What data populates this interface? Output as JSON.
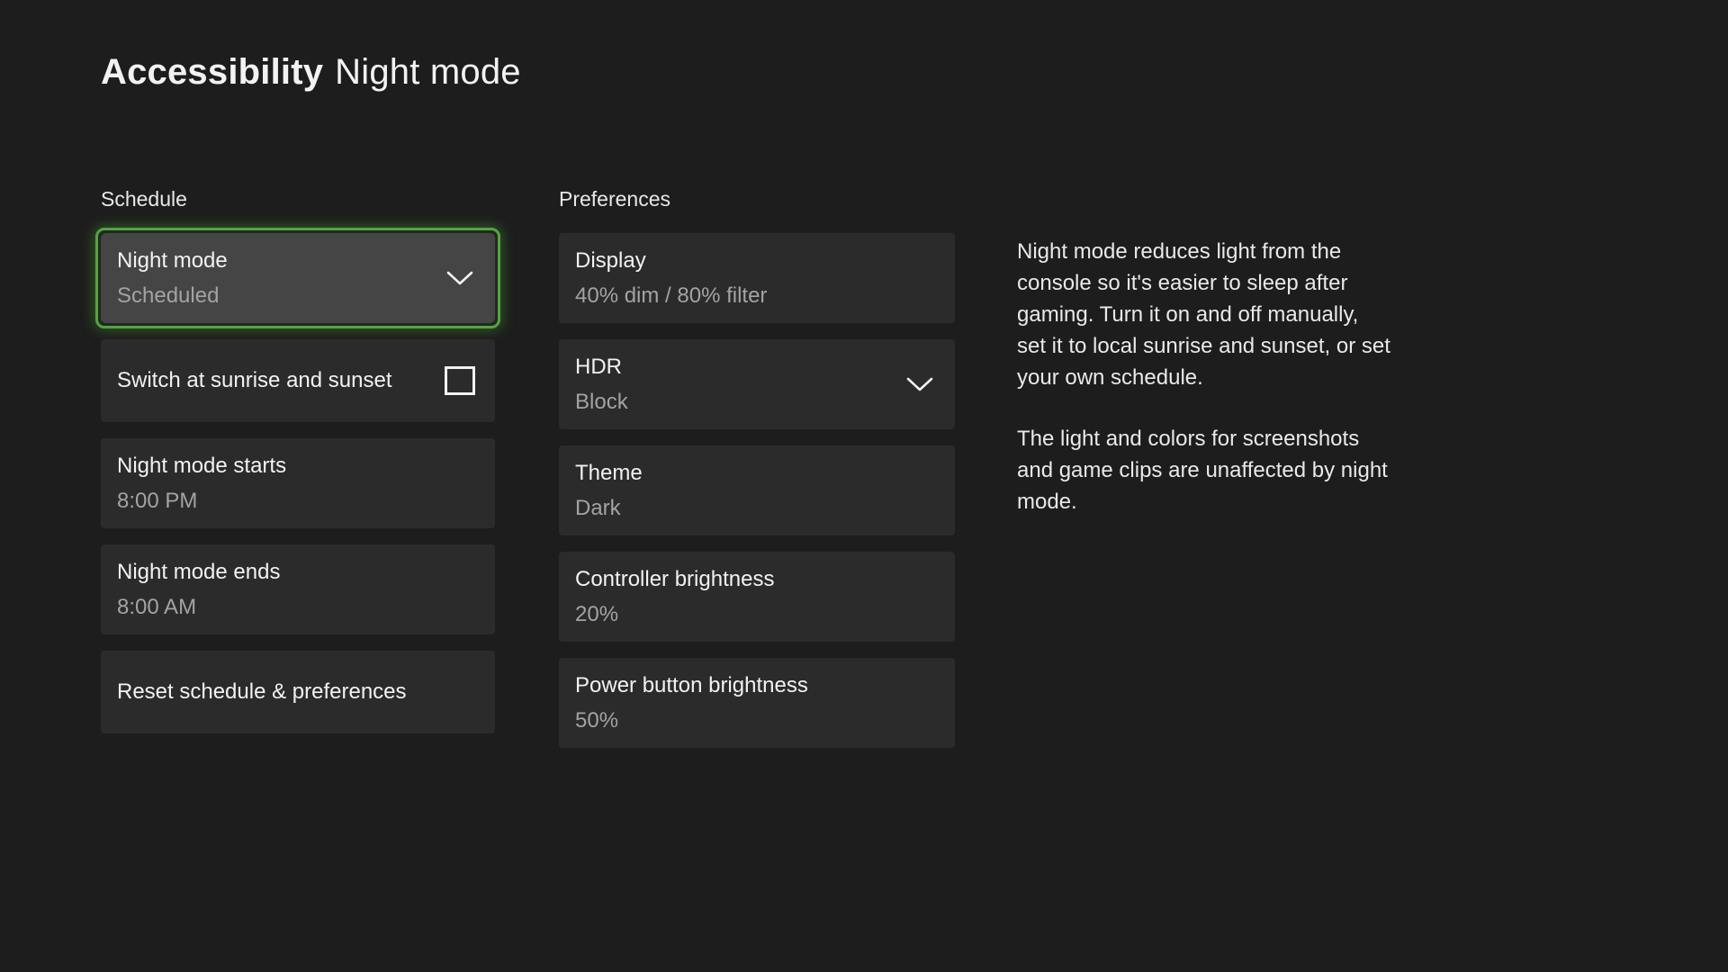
{
  "page": {
    "title_bold": "Accessibility",
    "title_regular": "Night mode"
  },
  "schedule": {
    "heading": "Schedule",
    "night_mode": {
      "label": "Night mode",
      "value": "Scheduled"
    },
    "sunrise_sunset": {
      "label": "Switch at sunrise and sunset",
      "checked": false
    },
    "starts": {
      "label": "Night mode starts",
      "value": "8:00 PM"
    },
    "ends": {
      "label": "Night mode ends",
      "value": "8:00 AM"
    },
    "reset": {
      "label": "Reset schedule & preferences"
    }
  },
  "preferences": {
    "heading": "Preferences",
    "display": {
      "label": "Display",
      "value": "40% dim / 80% filter"
    },
    "hdr": {
      "label": "HDR",
      "value": "Block"
    },
    "theme": {
      "label": "Theme",
      "value": "Dark"
    },
    "controller_brightness": {
      "label": "Controller brightness",
      "value": "20%"
    },
    "power_button_brightness": {
      "label": "Power button brightness",
      "value": "50%"
    }
  },
  "description": {
    "paragraph1": "Night mode reduces light from the console so it's easier to sleep after gaming. Turn it on and off manually, set it to local sunrise and sunset, or set your own schedule.",
    "paragraph2": "The light and colors for screenshots and game clips are unaffected by night mode."
  },
  "icons": {
    "chevron_down": "chevron-down-icon",
    "checkbox_unchecked": "checkbox-unchecked"
  },
  "colors": {
    "page_bg": "#1d1d1d",
    "card_bg": "#2b2b2b",
    "focused_card_bg": "#454545",
    "focus_ring": "#55a245",
    "text_primary": "#f2f2f2",
    "text_secondary": "#a3a3a3"
  }
}
